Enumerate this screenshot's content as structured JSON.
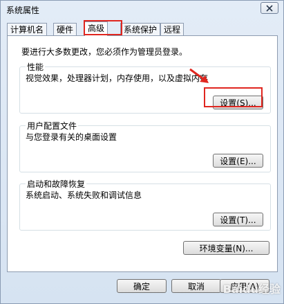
{
  "window": {
    "title": "系统属性"
  },
  "tabs": [
    {
      "label": "计算机名"
    },
    {
      "label": "硬件"
    },
    {
      "label": "高级"
    },
    {
      "label": "系统保护"
    },
    {
      "label": "远程"
    }
  ],
  "active_tab": "高级",
  "admin_note": "要进行大多数更改，您必须作为管理员登录。",
  "groups": {
    "performance": {
      "title": "性能",
      "desc": "视觉效果，处理器计划，内存使用，以及虚拟内存",
      "button": "设置(S)..."
    },
    "user_profiles": {
      "title": "用户配置文件",
      "desc": "与您登录有关的桌面设置",
      "button": "设置(E)..."
    },
    "startup": {
      "title": "启动和故障恢复",
      "desc": "系统启动、系统失败和调试信息",
      "button": "设置(T)..."
    }
  },
  "env_button": "环境变量(N)...",
  "footer": {
    "ok": "确定",
    "cancel": "取消",
    "apply": "应用(A)"
  },
  "icons": {
    "close": "close-icon"
  },
  "annotation_color": "#e0261f",
  "watermark": "Baidu经验"
}
